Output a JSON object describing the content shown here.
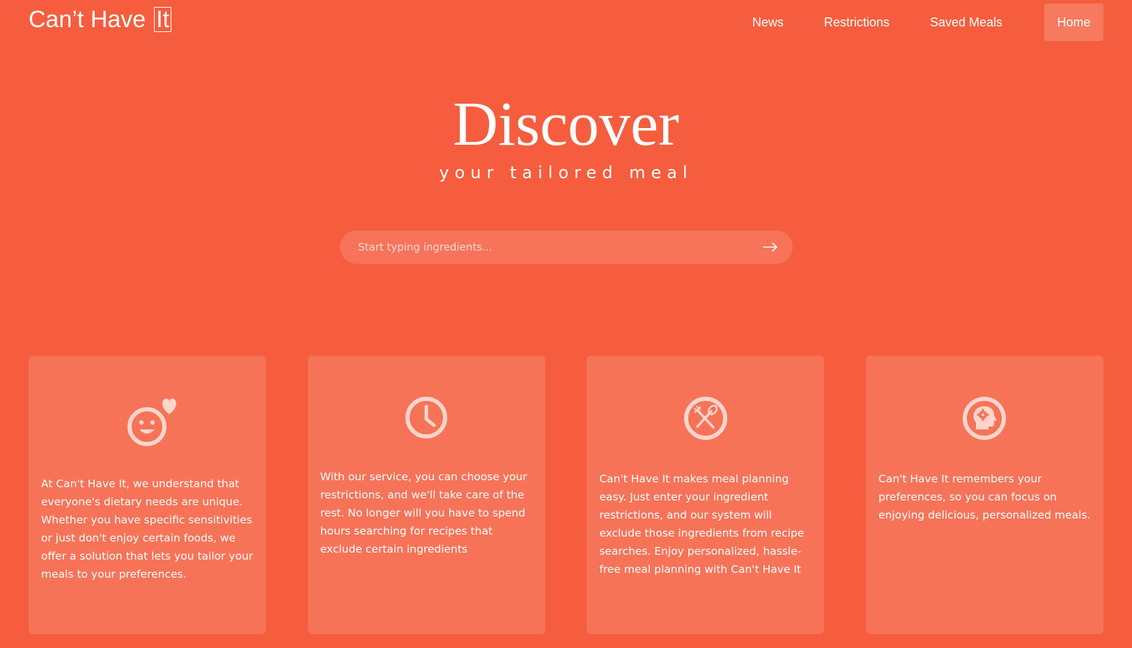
{
  "header": {
    "logo_text": "Can’t Have",
    "logo_box": "It",
    "nav": [
      {
        "label": "News"
      },
      {
        "label": "Restrictions"
      },
      {
        "label": "Saved Meals"
      },
      {
        "label": "Home"
      }
    ]
  },
  "hero": {
    "title": "Discover",
    "subtitle": "your tailored meal"
  },
  "search": {
    "placeholder": "Start typing ingredients...",
    "submit_icon": "arrow-right-icon"
  },
  "cards": [
    {
      "icon": "smiley-heart-icon",
      "text": "At Can't Have It, we understand that everyone's dietary needs are unique. Whether you have specific sensitivities or just don't enjoy certain foods, we offer a solution that lets you tailor your meals to your preferences."
    },
    {
      "icon": "clock-icon",
      "text": "With our service, you can choose your restrictions, and we'll take care of the rest. No longer will you have to spend hours searching for recipes that exclude certain ingredients"
    },
    {
      "icon": "fork-spoon-icon",
      "text": "Can't Have It makes meal planning easy. Just enter your ingredient restrictions, and our system will exclude those ingredients from recipe searches. Enjoy personalized, hassle-free meal planning with Can't Have It"
    },
    {
      "icon": "head-puzzle-icon",
      "text": "Can't Have It remembers your preferences, so you can focus on enjoying delicious, personalized meals."
    }
  ],
  "colors": {
    "background": "#f55d3e",
    "card": "#f67358",
    "icon": "#fcd5cb"
  }
}
